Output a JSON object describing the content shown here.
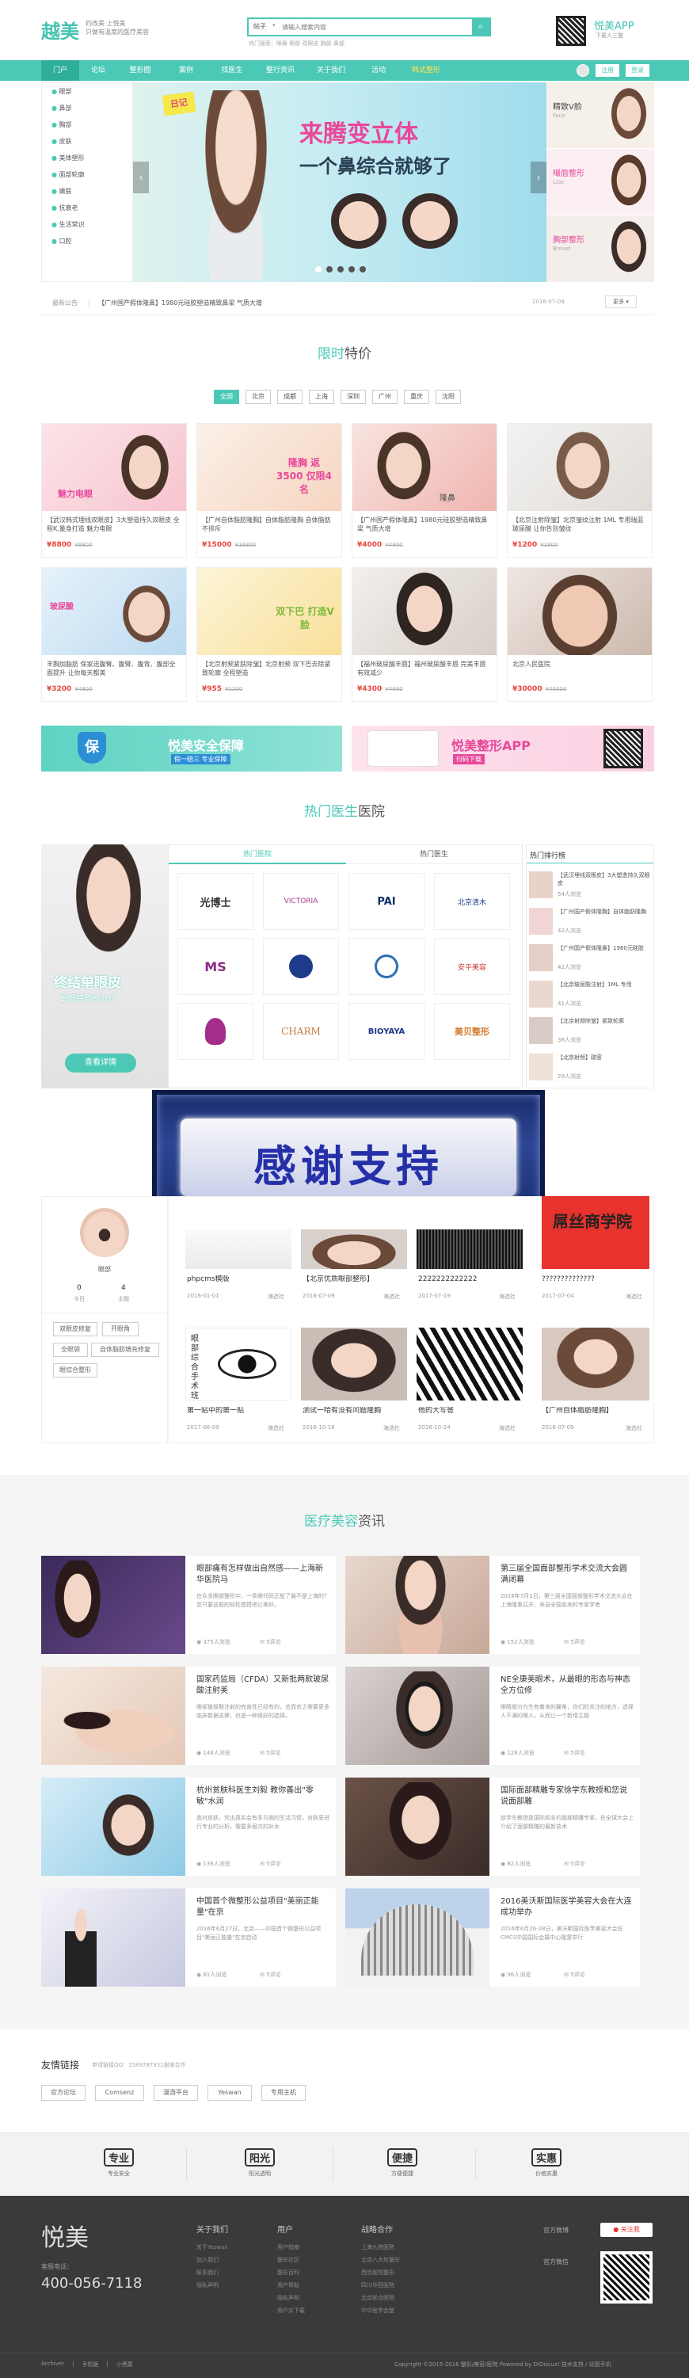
{
  "header": {
    "logo": "越美",
    "slogan1": "约改美 上悦美",
    "slogan2": "只做有温度的医疗美容",
    "search_select": "帖子",
    "search_placeholder": "请输入搜索内容",
    "search_hot": "热门搜索：眼鼻 眼部 双眼皮 胸部 鼻部",
    "app_title": "悦美APP",
    "app_sub": "下载人三整"
  },
  "nav": {
    "items": [
      "门户",
      "论坛",
      "整形圈",
      "案例",
      "找医生",
      "整行资讯",
      "关于我们",
      "活动",
      "韩式整形"
    ],
    "login": "注册",
    "register": "登录"
  },
  "sidebar": {
    "items": [
      "眼部",
      "鼻部",
      "胸部",
      "皮肤",
      "美体塑形",
      "面部轮廓",
      "嫩肤",
      "抗衰老",
      "生活常识",
      "口腔"
    ]
  },
  "banner": {
    "badge": "日记",
    "slogan_line1": "来腾变立体",
    "slogan_line2": "一个鼻综合就够了"
  },
  "banner_side": [
    {
      "title": "精致V脸",
      "sub": "Face"
    },
    {
      "title": "嘬唇整形",
      "sub": "Lips"
    },
    {
      "title": "胸部整形",
      "sub": "Breast"
    }
  ],
  "notice": {
    "label": "最新公告",
    "text": "【广州国产假体隆鼻】1980元硅胶塑造精致鼻梁 气质大增",
    "date": "2016-07-09",
    "more": "更多"
  },
  "limited": {
    "title_a": "限时",
    "title_b": "特价",
    "cities": [
      "全国",
      "北京",
      "成都",
      "上海",
      "深圳",
      "广州",
      "重庆",
      "沈阳"
    ]
  },
  "deals": [
    {
      "title": "【武汉韩式埋线双眼皮】3大塑造持久双眼皮 全程K,量身打造 魅力电眼",
      "price": "¥8800",
      "old": "¥9800",
      "img_text": "魅力电眼"
    },
    {
      "title": "【广州自体脂肪隆胸】自体脂肪隆胸 自体脂肪不排斥",
      "price": "¥15000",
      "old": "¥16800",
      "img_text": "隆胸 返3500 仅限4名"
    },
    {
      "title": "【广州国产假体隆鼻】1980元硅胶塑造精致鼻梁 气质大增",
      "price": "¥4000",
      "old": "¥4800",
      "img_text": "隆鼻"
    },
    {
      "title": "【北京注射除皱】北京皱纹注射 1ML 专用瑞蓝玻尿酸 让你告别皱纹",
      "price": "¥1200",
      "old": "¥1800",
      "img_text": ""
    },
    {
      "title": "丰胸加脂肪 保家送腹臀、腹臂、腹背、腹部全面提升 让你每天都美",
      "price": "¥3200",
      "old": "¥4800",
      "img_text": "玻尿酸"
    },
    {
      "title": "【北京射频紧肤除皱】北京射频 双下巴去除紧致轮廓 全程塑造",
      "price": "¥955",
      "old": "¥1200",
      "img_text": "双下巴 打造V脸"
    },
    {
      "title": "【福州玻尿酸丰唇】福州玻尿酸丰唇 完美丰唇 有效减少",
      "price": "¥4300",
      "old": "¥4800",
      "img_text": ""
    },
    {
      "title": "北京人民医院",
      "price": "¥30000",
      "old": "¥40000",
      "img_text": ""
    }
  ],
  "ad_banners": [
    {
      "title": "悦美安全保障",
      "sub": "假一赔三 专业保障"
    },
    {
      "title": "悦美整形APP",
      "sub": "扫码下载"
    }
  ],
  "hot": {
    "title_a": "热门医生",
    "title_b": "医院",
    "tabs": [
      "热门医院",
      "热门医生"
    ],
    "rank_title": "热门排行榜",
    "promo_title": "终结单眼皮",
    "promo_sub": "最低只要680元",
    "promo_btn": "查看详情",
    "hospitals": [
      "光博士",
      "VICTORIA",
      "PAI",
      "北京清木",
      "MS",
      "",
      "",
      "安平美容",
      "",
      "CHARM",
      "BIOYAYA",
      "美贝整形"
    ],
    "ranks": [
      {
        "t": "【武汉埋线双眼皮】3大塑造持久双眼皮",
        "c": "54人浏览"
      },
      {
        "t": "【广州国产假体隆胸】自体脂肪隆胸",
        "c": "42人浏览"
      },
      {
        "t": "【广州国产假体隆鼻】1980元硅胶",
        "c": "42人浏览"
      },
      {
        "t": "【北京玻尿酸注射】1ML 专用",
        "c": "41人浏览"
      },
      {
        "t": "【北京射频除皱】紧致轮廓",
        "c": "38人浏览"
      },
      {
        "t": "【北京射频】疏密",
        "c": "29人浏览"
      }
    ]
  },
  "thanks": "感谢支持",
  "profile": {
    "name": "眼部",
    "stat1_num": "0",
    "stat1_label": "今日",
    "stat2_num": "4",
    "stat2_label": "主题",
    "tags": [
      "双眼皮修复",
      "开眼角",
      "全眼袋",
      "自体脂肪填充修复",
      "眼综合整形"
    ]
  },
  "posts": [
    {
      "title": "phpcms模版",
      "date": "2016-01-01",
      "cat": "海选社"
    },
    {
      "title": "【北京优质眼部整形】",
      "date": "2016-07-09",
      "cat": "海选社"
    },
    {
      "title": "2222222222222",
      "date": "2017-07-19",
      "cat": "海选社"
    },
    {
      "title": "??????????????",
      "date": "2017-07-04",
      "cat": "海选社"
    },
    {
      "title": "第一贴中的第一贴",
      "date": "2017-06-09",
      "cat": "海选社"
    },
    {
      "title": "测试一哈有没有问题隆胸",
      "date": "2016-10-16",
      "cat": "海选社"
    },
    {
      "title": "他的大写爸",
      "date": "2016-10-24",
      "cat": "海选社"
    },
    {
      "title": "【广州自体脂肪隆胸】",
      "date": "2016-07-09",
      "cat": "海选社"
    }
  ],
  "post_imgs": {
    "p4_text": "屌丝商学院",
    "p5_text": "眼部综合手术班"
  },
  "news": {
    "title_a": "医疗美容",
    "title_b": "资讯",
    "items": [
      {
        "title": "眼部痛有怎样做出自然感——上海新华医院马",
        "desc": "在众多眼部整形中，一条眼代码正般了最不是上海的？您只要这般的轻松摸摸吧让美好。",
        "views": "375人浏览",
        "comments": "5评论"
      },
      {
        "title": "第三届全国面部整形学术交流大会圆满闭幕",
        "desc": "2016年7月1日，第三届全国面部整形学术交流大会在上海隆重召开，来自全国各地的专家学者",
        "views": "152人浏览",
        "comments": "5评论"
      },
      {
        "title": "国家药监局（CFDA）又新批两款玻尿酸注射美",
        "desc": "眼部玻尿酸注射的完善性已经有的，总而言之需要更多临床数据支撑，也是一种很好的选择。",
        "views": "148人浏览",
        "comments": "5评论"
      },
      {
        "title": "NE全康美眼术，从最眼的形态与神态全方位修",
        "desc": "眼睛部分为生有着地的翼角，你们的关注的地方，选择人不满的眼人，从而让一个新增主题",
        "views": "128人浏览",
        "comments": "5评论"
      },
      {
        "title": "杭州贫肤科医生刘毅 教你善出\"零敏\"水润",
        "desc": "面对皮肤，究出真实会有多方面的生活习惯，对肤质进行专业的分析，需要多层次的补水",
        "views": "136人浏览",
        "comments": "5评论"
      },
      {
        "title": "国际面部精雕专家徐学东教授和您说说面部雕",
        "desc": "徐学东教授是国际知名的面部精雕专家，在全球大会上介绍了面部精雕的最新技术",
        "views": "82人浏览",
        "comments": "5评论"
      },
      {
        "title": "中国首个微整形公益项目\"美丽正能量\"在京",
        "desc": "2016年6月27日，北京——中国首个微整形公益项目\"美丽正能量\"在京启动",
        "views": "81人浏览",
        "comments": "5评论"
      },
      {
        "title": "2016美沃斯国际医学美容大会在大连成功举办",
        "desc": "2016年6月26-28日，美沃斯国际医学美容大会在CMCS中国国际会展中心隆重举行",
        "views": "96人浏览",
        "comments": "5评论"
      }
    ]
  },
  "links": {
    "title": "友情链接",
    "note": "申请链接QQ：1589787931谢谢合作",
    "items": [
      "官方论坛",
      "Comsenz",
      "漫游平台",
      "Yeswan",
      "专用主机"
    ]
  },
  "guarantees": [
    {
      "icon": "专业",
      "label": "专业安全"
    },
    {
      "icon": "阳光",
      "label": "阳光透明"
    },
    {
      "icon": "便捷",
      "label": "方便便捷"
    },
    {
      "icon": "实惠",
      "label": "价格实惠"
    }
  ],
  "footer": {
    "logo": "悦美",
    "phone_label": "客服电话：",
    "phone": "400-056-7118",
    "cols": [
      {
        "title": "关于我们",
        "items": [
          "关于Yeswan",
          "加入我们",
          "联系我们",
          "隐私声明"
        ]
      },
      {
        "title": "用户",
        "items": [
          "用户指南",
          "整形社区",
          "整形百科",
          "用户帮助",
          "隐私声明",
          "用户实下载"
        ]
      },
      {
        "title": "战略合作",
        "items": [
          "上海九院医院",
          "北京八大处整形",
          "西京医院整形",
          "四川华西医院",
          "北京联合医院",
          "中华医学会整"
        ]
      }
    ],
    "follow1": "官方微博",
    "follow2": "官方微信",
    "weibo": "关注我",
    "bottom_left": [
      "Archiver",
      "手机版",
      "小黑屋"
    ],
    "copyright": "Copyright ©2015-2016 整形/美容/医院 Powered by DiDiscuz! 技术支持 / 站图手机"
  }
}
